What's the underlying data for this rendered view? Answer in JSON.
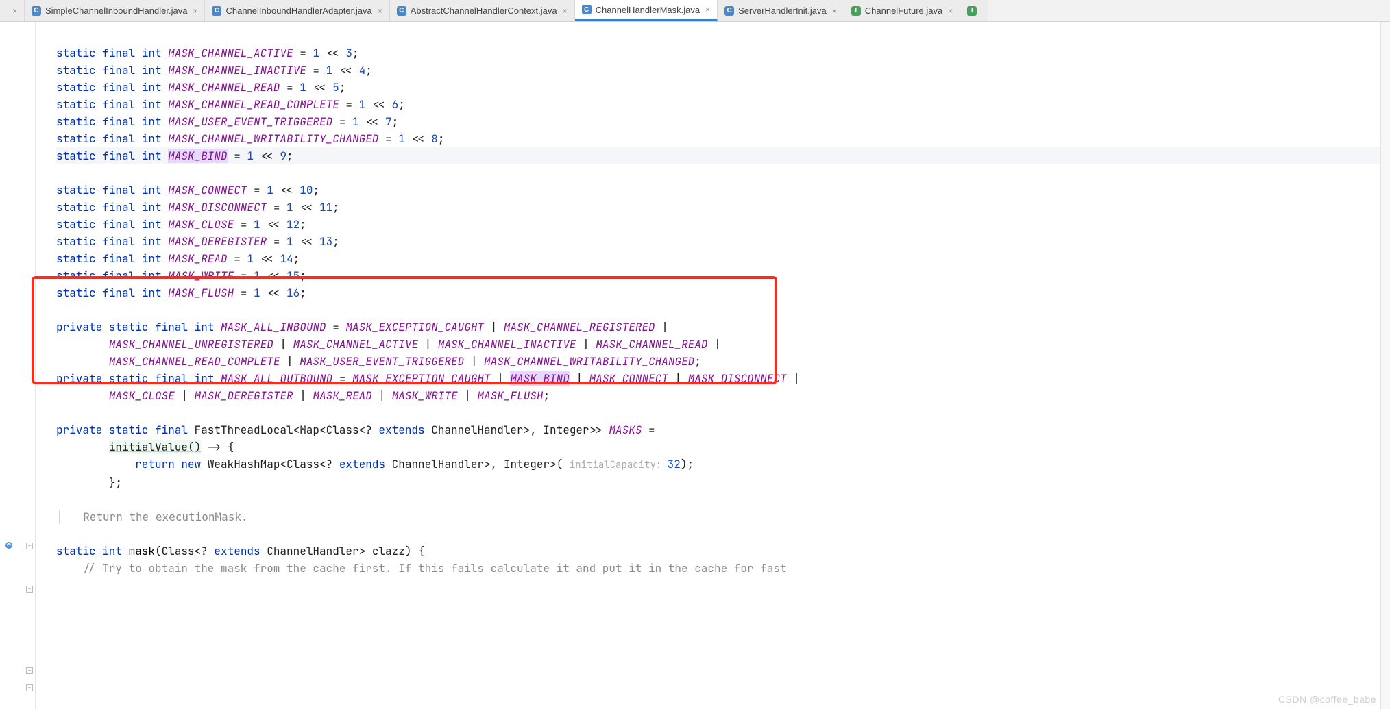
{
  "tabs": [
    {
      "label": "SimpleChannelInboundHandler.java",
      "icon": "c",
      "active": false
    },
    {
      "label": "ChannelInboundHandlerAdapter.java",
      "icon": "c",
      "active": false
    },
    {
      "label": "AbstractChannelHandlerContext.java",
      "icon": "c",
      "active": false
    },
    {
      "label": "ChannelHandlerMask.java",
      "icon": "c",
      "active": true
    },
    {
      "label": "ServerHandlerInit.java",
      "icon": "c",
      "active": false
    },
    {
      "label": "ChannelFuture.java",
      "icon": "i",
      "active": false
    }
  ],
  "lines": {
    "l1": {
      "pre": "static final int ",
      "f": "MASK_CHANNEL_ACTIVE",
      "mid": " = ",
      "n1": "1",
      "op": " << ",
      "n2": "3",
      "end": ";"
    },
    "l2": {
      "pre": "static final int ",
      "f": "MASK_CHANNEL_INACTIVE",
      "mid": " = ",
      "n1": "1",
      "op": " << ",
      "n2": "4",
      "end": ";"
    },
    "l3": {
      "pre": "static final int ",
      "f": "MASK_CHANNEL_READ",
      "mid": " = ",
      "n1": "1",
      "op": " << ",
      "n2": "5",
      "end": ";"
    },
    "l4": {
      "pre": "static final int ",
      "f": "MASK_CHANNEL_READ_COMPLETE",
      "mid": " = ",
      "n1": "1",
      "op": " << ",
      "n2": "6",
      "end": ";"
    },
    "l5": {
      "pre": "static final int ",
      "f": "MASK_USER_EVENT_TRIGGERED",
      "mid": " = ",
      "n1": "1",
      "op": " << ",
      "n2": "7",
      "end": ";"
    },
    "l6": {
      "pre": "static final int ",
      "f": "MASK_CHANNEL_WRITABILITY_CHANGED",
      "mid": " = ",
      "n1": "1",
      "op": " << ",
      "n2": "8",
      "end": ";"
    },
    "l7": {
      "pre": "static final int ",
      "f": "MASK_BIND",
      "mid": " = ",
      "n1": "1",
      "op": " << ",
      "n2": "9",
      "end": ";"
    },
    "l8": {
      "pre": "static final int ",
      "f": "MASK_CONNECT",
      "mid": " = ",
      "n1": "1",
      "op": " << ",
      "n2": "10",
      "end": ";"
    },
    "l9": {
      "pre": "static final int ",
      "f": "MASK_DISCONNECT",
      "mid": " = ",
      "n1": "1",
      "op": " << ",
      "n2": "11",
      "end": ";"
    },
    "l10": {
      "pre": "static final int ",
      "f": "MASK_CLOSE",
      "mid": " = ",
      "n1": "1",
      "op": " << ",
      "n2": "12",
      "end": ";"
    },
    "l11": {
      "pre": "static final int ",
      "f": "MASK_DEREGISTER",
      "mid": " = ",
      "n1": "1",
      "op": " << ",
      "n2": "13",
      "end": ";"
    },
    "l12": {
      "pre": "static final int ",
      "f": "MASK_READ",
      "mid": " = ",
      "n1": "1",
      "op": " << ",
      "n2": "14",
      "end": ";"
    },
    "l13": {
      "pre": "static final int ",
      "f": "MASK_WRITE",
      "mid": " = ",
      "n1": "1",
      "op": " << ",
      "n2": "15",
      "end": ";"
    },
    "l14": {
      "pre": "static final int ",
      "f": "MASK_FLUSH",
      "mid": " = ",
      "n1": "1",
      "op": " << ",
      "n2": "16",
      "end": ";"
    }
  },
  "inbound": {
    "h": "private static final int ",
    "name": "MASK_ALL_INBOUND",
    "parts": [
      "MASK_EXCEPTION_CAUGHT",
      "MASK_CHANNEL_REGISTERED",
      "MASK_CHANNEL_UNREGISTERED",
      "MASK_CHANNEL_ACTIVE",
      "MASK_CHANNEL_INACTIVE",
      "MASK_CHANNEL_READ",
      "MASK_CHANNEL_READ_COMPLETE",
      "MASK_USER_EVENT_TRIGGERED",
      "MASK_CHANNEL_WRITABILITY_CHANGED"
    ]
  },
  "outbound": {
    "h": "private static final int ",
    "name": "MASK_ALL_OUTBOUND",
    "parts": [
      "MASK_EXCEPTION_CAUGHT",
      "MASK_BIND",
      "MASK_CONNECT",
      "MASK_DISCONNECT",
      "MASK_CLOSE",
      "MASK_DEREGISTER",
      "MASK_READ",
      "MASK_WRITE",
      "MASK_FLUSH"
    ]
  },
  "masksLine": {
    "a": "private static final ",
    "b": "FastThreadLocal<Map<Class<? ",
    "c": "extends ",
    "d": "ChannelHandler>, Integer>> ",
    "e": "MASKS",
    "f": " ="
  },
  "initLine": {
    "a": "initialValue()",
    "b": " -> {"
  },
  "returnLine": {
    "a": "return new ",
    "b": "WeakHashMap<Class<? ",
    "c": "extends ",
    "d": "ChannelHandler>, Integer>( ",
    "hint": "initialCapacity: ",
    "num": "32",
    "e": ");"
  },
  "closeBrace": "};",
  "javadoc": {
    "a": "Return the ",
    "b": "executionMask",
    "c": "."
  },
  "maskMethod": {
    "a": "static int ",
    "b": "mask",
    "c": "(Class<? ",
    "d": "extends ",
    "e": "ChannelHandler> clazz) {"
  },
  "comment": "// Try to obtain the mask from the cache first. If this fails calculate it and put it in the cache for fast",
  "watermark": "CSDN @coffee_babe"
}
